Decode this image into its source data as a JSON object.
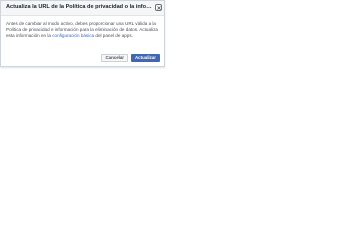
{
  "dialog": {
    "title": "Actualiza la URL de la Política de privacidad o la informaci...",
    "close_icon": "close-icon",
    "body_text_before_link": "Antes de cambiar al modo activo, debes proporcionar una URL válida a la Política de privacidad e información para la eliminación de datos. Actualiza esta información en la ",
    "body_link": "configuración básica",
    "body_text_after_link": " del panel de apps.",
    "cancel_label": "Cancelar",
    "confirm_label": "Actualizar"
  },
  "colors": {
    "primary": "#4267b2",
    "link": "#4267b2",
    "header_bg": "#f5f6f7",
    "text": "#4b4f56"
  }
}
